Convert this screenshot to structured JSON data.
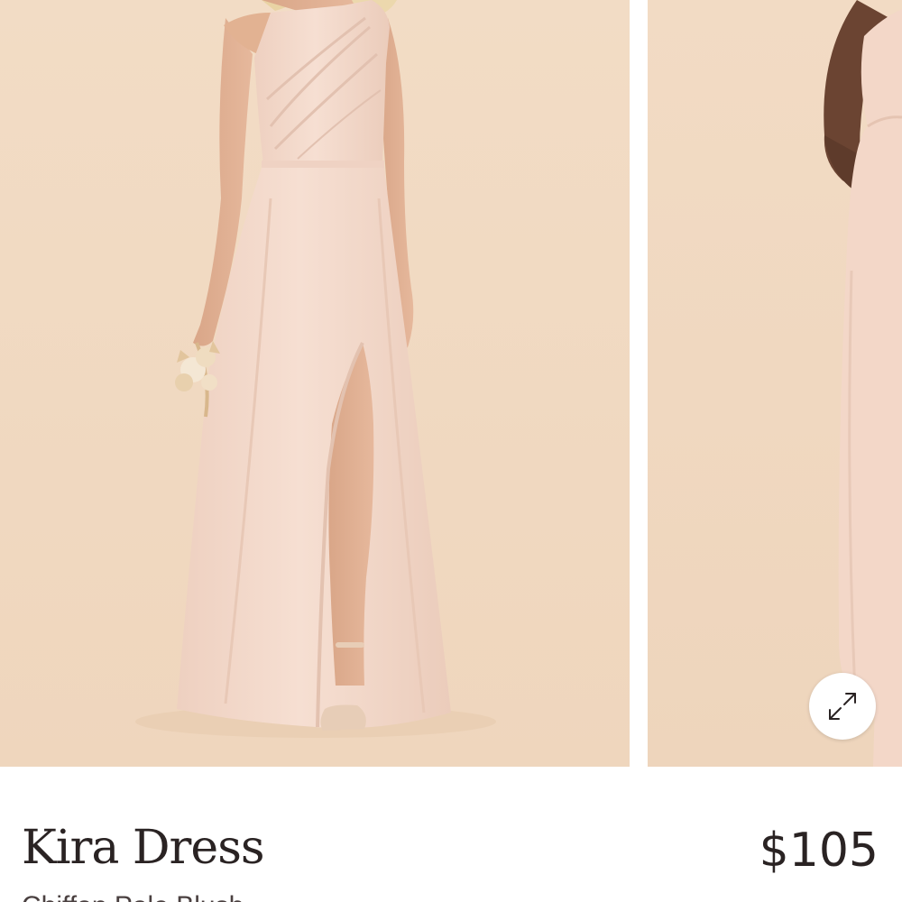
{
  "product": {
    "name": "Kira Dress",
    "price": "$105",
    "subtitle": "Chiffon Pale Blush"
  },
  "gallery": {
    "images": [
      {
        "alt": "Model wearing one-shoulder chiffon dress with side slit, holding dried flower bouquet"
      },
      {
        "alt": "Second model wearing the dress, partially visible"
      }
    ],
    "expand_icon": "expand-arrows-icon"
  },
  "colors": {
    "backdrop": "#f1d9c1",
    "dress": "#f3d7c8",
    "text": "#2a2323"
  }
}
